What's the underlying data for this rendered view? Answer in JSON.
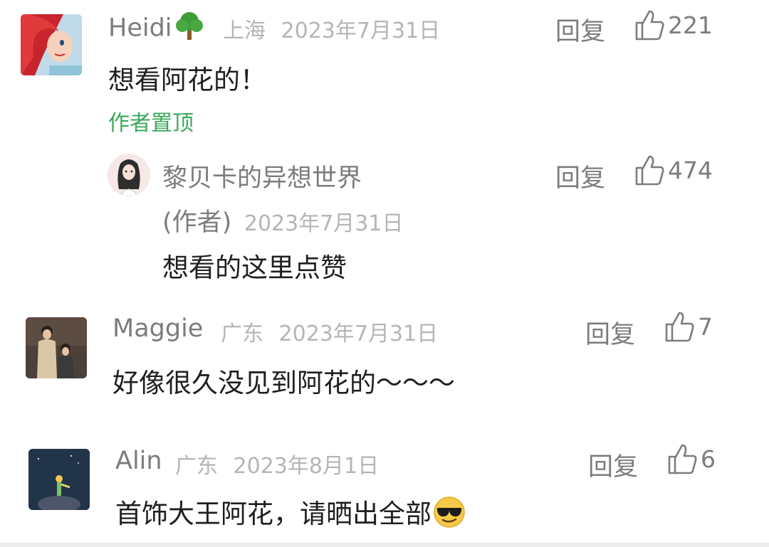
{
  "reply_label": "回复",
  "comments": [
    {
      "name": "Heidi",
      "location": "上海",
      "date": "2023年7月31日",
      "text": "想看阿花的！",
      "likes": "221",
      "pinned_label": "作者置顶",
      "avatar_icon": "red-hair-mermaid-avatar",
      "name_icon": "tree-emoji"
    },
    {
      "name": "黎贝卡的异想世界",
      "author_tag": "(作者)",
      "date": "2023年7月31日",
      "text": "想看的这里点赞",
      "likes": "474",
      "avatar_icon": "illustrated-woman-avatar"
    },
    {
      "name": "Maggie",
      "location": "广东",
      "date": "2023年7月31日",
      "text": "好像很久没见到阿花的～～～",
      "likes": "7",
      "avatar_icon": "family-photo-avatar"
    },
    {
      "name": "Alin",
      "location": "广东",
      "date": "2023年8月1日",
      "text": "首饰大王阿花，请晒出全部",
      "likes": "6",
      "avatar_icon": "little-prince-avatar",
      "text_emoji": "sunglasses-emoji"
    }
  ],
  "colors": {
    "meta_gray": "#7c7c7c",
    "light_gray": "#b5b5b5",
    "pin_green": "#3aa85a"
  }
}
